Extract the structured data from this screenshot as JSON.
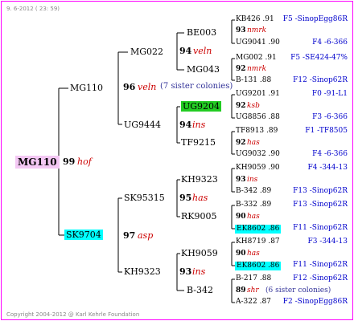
{
  "date_label": "9.  6-2012 ( 23: 59)",
  "copyright": "Copyright 2004-2012 @ Karl Kehrle Foundation",
  "colors": {
    "border": "#ff00ff",
    "root_bg": "#f4c8f4",
    "green_bg": "#22cc22",
    "cyan_bg": "#00ffff",
    "blue_text": "#0000cc",
    "red_text": "#cc0000"
  },
  "root": {
    "name": "MG110",
    "year": "99",
    "tag": "hof"
  },
  "sire": {
    "name": "MG110",
    "year": "96",
    "tag": "veln",
    "note": "(7 sister colonies)"
  },
  "dam": {
    "name": "SK9704",
    "year": "97",
    "tag": "asp"
  },
  "gen3": {
    "mg022": {
      "name": "MG022",
      "year": "94",
      "tag": "veln"
    },
    "ug9444": {
      "name": "UG9444",
      "year": "94",
      "tag": "ins"
    },
    "sk95315": {
      "name": "SK95315",
      "year": "95",
      "tag": "has"
    },
    "kh9323": {
      "name": "KH9323",
      "year": "93",
      "tag": "ins"
    }
  },
  "gen4": [
    {
      "name": "BE003"
    },
    {
      "name": "MG043"
    },
    {
      "name": "UG9204"
    },
    {
      "name": "TF9215"
    },
    {
      "name": "KH9323"
    },
    {
      "name": "RK9005"
    },
    {
      "name": "KH9059"
    },
    {
      "name": "B-342"
    }
  ],
  "gen4_years": [
    {
      "year": "93",
      "tag": "nmrk"
    },
    {
      "year": "92",
      "tag": "nmrk"
    },
    {
      "year": "92",
      "tag": "ksb"
    },
    {
      "year": "92",
      "tag": "has"
    },
    {
      "year": "93",
      "tag": "ins"
    },
    {
      "year": "90",
      "tag": "has"
    },
    {
      "year": "90",
      "tag": "has"
    },
    {
      "year": "89",
      "tag": "shr",
      "note": "(6 sister colonies)"
    }
  ],
  "gen5": [
    {
      "name": "KB426 .91",
      "right": "F5 -SinopEgg86R"
    },
    {
      "name": "UG9041 .90",
      "right": "F4 -6-366"
    },
    {
      "name": "MG002 .91",
      "right": "F5 -SE424-47%"
    },
    {
      "name": "B-131 .88",
      "right": "F12 -Sinop62R"
    },
    {
      "name": "UG9201 .91",
      "right": "F0 -91-L1"
    },
    {
      "name": "UG8856 .88",
      "right": "F3 -6-366"
    },
    {
      "name": "TF8913 .89",
      "right": "F1 -TF8505"
    },
    {
      "name": "UG9032 .90",
      "right": "F4 -6-366"
    },
    {
      "name": "KH9059 .90",
      "right": "F4 -344-13"
    },
    {
      "name": "B-342 .89",
      "right": "F13 -Sinop62R"
    },
    {
      "name": "B-332 .89",
      "right": "F13 -Sinop62R"
    },
    {
      "name": "EK8602 .86",
      "right": "F11 -Sinop62R"
    },
    {
      "name": "KH8719 .87",
      "right": "F3 -344-13"
    },
    {
      "name": "EK8602 .86",
      "right": "F11 -Sinop62R"
    },
    {
      "name": "B-217 .88",
      "right": "F12 -Sinop62R"
    },
    {
      "name": "A-322 .87",
      "right": "F2 -SinopEgg86R"
    }
  ]
}
